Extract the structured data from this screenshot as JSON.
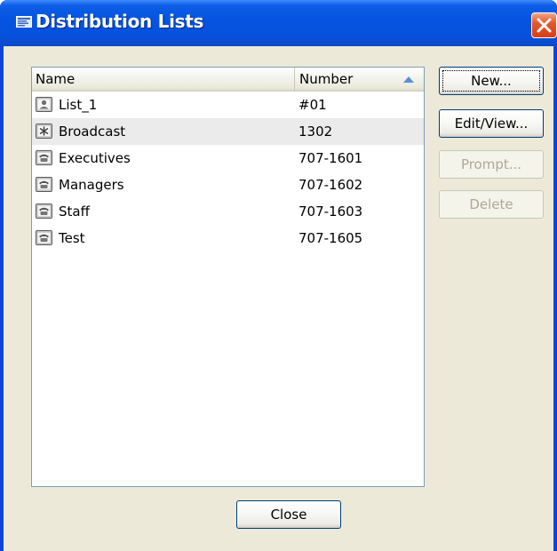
{
  "window": {
    "title": "Distribution Lists",
    "icon": "distribution-list-icon",
    "close_icon": "close-x-icon"
  },
  "list": {
    "columns": {
      "name": "Name",
      "number": "Number"
    },
    "sort_column": "Number",
    "sort_direction": "ascending",
    "rows": [
      {
        "name": "List_1",
        "number": "#01",
        "icon": "personal-list-icon",
        "selected": false
      },
      {
        "name": "Broadcast",
        "number": "1302",
        "icon": "broadcast-list-icon",
        "selected": true
      },
      {
        "name": "Executives",
        "number": "707-1601",
        "icon": "phone-list-icon",
        "selected": false
      },
      {
        "name": "Managers",
        "number": "707-1602",
        "icon": "phone-list-icon",
        "selected": false
      },
      {
        "name": "Staff",
        "number": "707-1603",
        "icon": "phone-list-icon",
        "selected": false
      },
      {
        "name": "Test",
        "number": "707-1605",
        "icon": "phone-list-icon",
        "selected": false
      }
    ]
  },
  "buttons": {
    "new": {
      "label": "New...",
      "enabled": true,
      "focused": true
    },
    "edit_view": {
      "label": "Edit/View...",
      "enabled": true
    },
    "prompt": {
      "label": "Prompt...",
      "enabled": false
    },
    "delete": {
      "label": "Delete",
      "enabled": false
    },
    "close": {
      "label": "Close",
      "enabled": true
    }
  },
  "colors": {
    "titlebar": "#0553e0",
    "client_background": "#ece9d8",
    "close_button": "#e2582f",
    "selected_row": "#ebebeb",
    "sort_arrow": "#5a8fd8"
  }
}
